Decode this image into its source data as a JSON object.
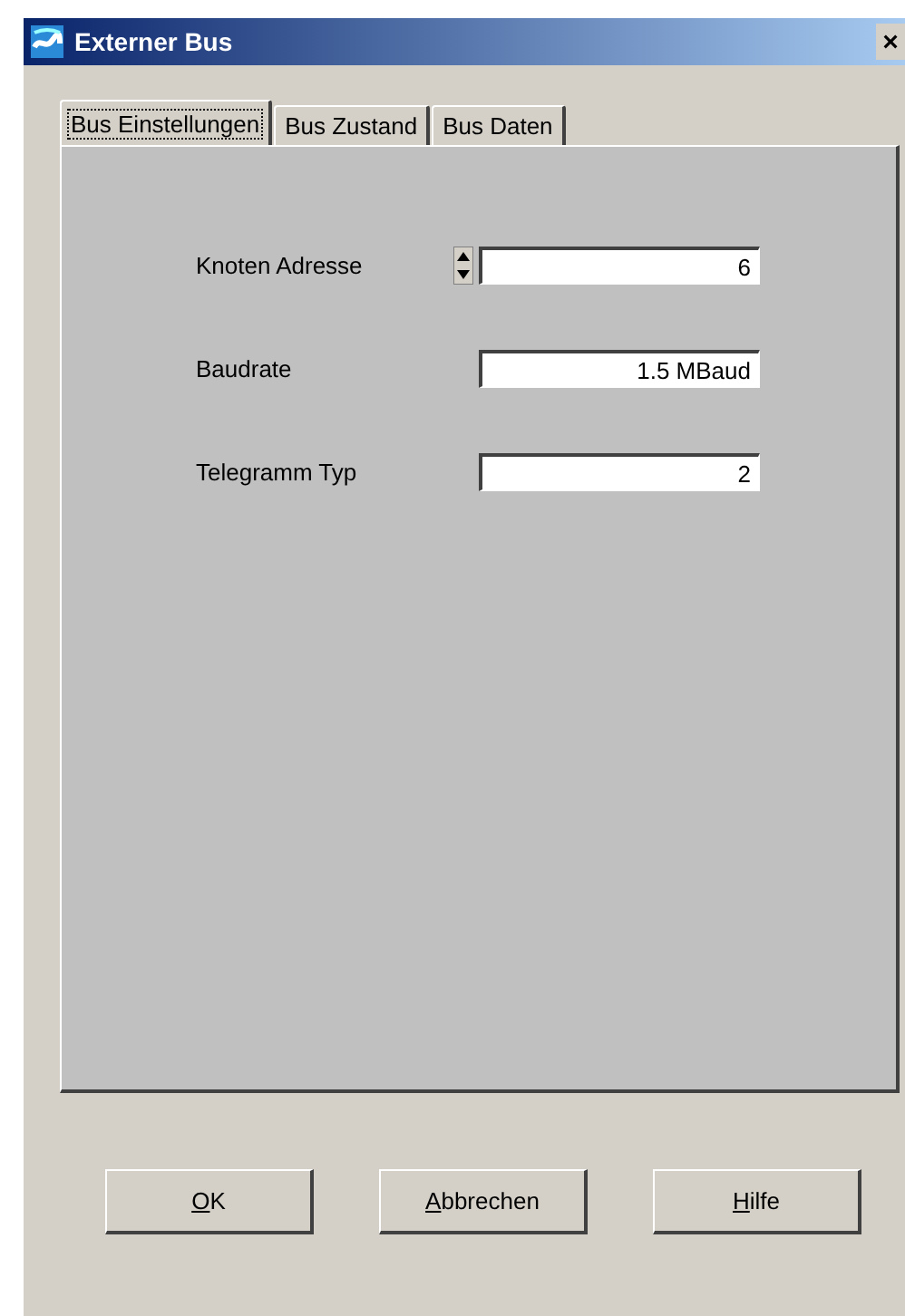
{
  "window": {
    "title": "Externer Bus",
    "close": "×"
  },
  "tabs": [
    {
      "label": "Bus Einstellungen",
      "selected": true
    },
    {
      "label": "Bus Zustand",
      "selected": false
    },
    {
      "label": "Bus Daten",
      "selected": false
    }
  ],
  "fields": [
    {
      "label": "Knoten Adresse",
      "value": "6",
      "kind": "spin"
    },
    {
      "label": "Baudrate",
      "value": "1.5 MBaud",
      "kind": "text"
    },
    {
      "label": "Telegramm Typ",
      "value": "2",
      "kind": "text"
    }
  ],
  "buttons": [
    "OK",
    "Abbrechen",
    "Hilfe"
  ]
}
